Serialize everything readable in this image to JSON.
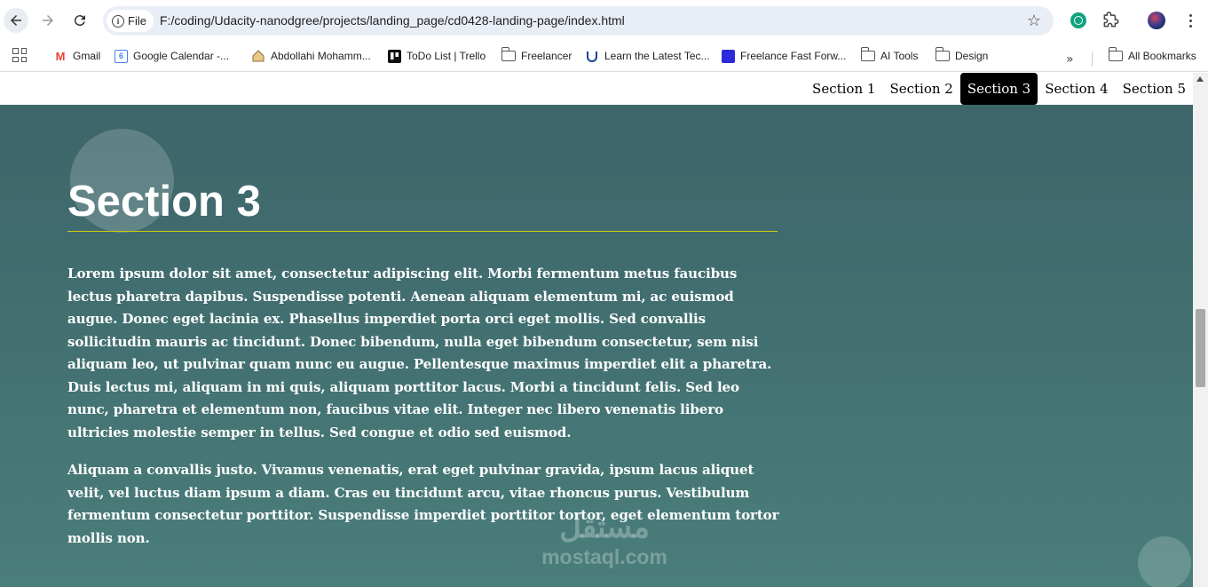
{
  "browser": {
    "url": "F:/coding/Udacity-nanodgree/projects/landing_page/cd0428-landing-page/index.html",
    "security_chip": "File",
    "info_glyph": "i",
    "star_glyph": "☆"
  },
  "bookmarks": {
    "items": [
      {
        "label": "Gmail",
        "icon": "gmail-icon"
      },
      {
        "label": "Google Calendar -...",
        "icon": "calendar-icon"
      },
      {
        "label": "Abdollahi Mohamm...",
        "icon": "house-icon"
      },
      {
        "label": "ToDo List | Trello",
        "icon": "trello-icon"
      },
      {
        "label": "Freelancer",
        "icon": "folder-icon"
      },
      {
        "label": "Learn the Latest Tec...",
        "icon": "udacity-icon"
      },
      {
        "label": "Freelance Fast Forw...",
        "icon": "ff-icon"
      },
      {
        "label": "AI Tools",
        "icon": "folder-icon"
      },
      {
        "label": "Design",
        "icon": "folder-icon"
      }
    ],
    "overflow": "»",
    "all_bookmarks": "All Bookmarks",
    "calendar_glyph": "6",
    "gmail_glyph": "M"
  },
  "page": {
    "nav": [
      "Section 1",
      "Section 2",
      "Section 3",
      "Section 4",
      "Section 5"
    ],
    "active_nav_index": 2,
    "section_title": "Section 3",
    "paragraphs": [
      "Lorem ipsum dolor sit amet, consectetur adipiscing elit. Morbi fermentum metus faucibus lectus pharetra dapibus. Suspendisse potenti. Aenean aliquam elementum mi, ac euismod augue. Donec eget lacinia ex. Phasellus imperdiet porta orci eget mollis. Sed convallis sollicitudin mauris ac tincidunt. Donec bibendum, nulla eget bibendum consectetur, sem nisi aliquam leo, ut pulvinar quam nunc eu augue. Pellentesque maximus imperdiet elit a pharetra. Duis lectus mi, aliquam in mi quis, aliquam porttitor lacus. Morbi a tincidunt felis. Sed leo nunc, pharetra et elementum non, faucibus vitae elit. Integer nec libero venenatis libero ultricies molestie semper in tellus. Sed congue et odio sed euismod.",
      "Aliquam a convallis justo. Vivamus venenatis, erat eget pulvinar gravida, ipsum lacus aliquet velit, vel luctus diam ipsum a diam. Cras eu tincidunt arcu, vitae rhoncus purus. Vestibulum fermentum consectetur porttitor. Suspendisse imperdiet porttitor tortor, eget elementum tortor mollis non."
    ],
    "watermark_top": "مستقل",
    "watermark_bottom": "mostaql.com"
  },
  "colors": {
    "page_bg_top": "#3e6469",
    "page_bg_bottom": "#4a7e7a",
    "title_underline": "#cccc11",
    "active_nav_bg": "#000000"
  }
}
